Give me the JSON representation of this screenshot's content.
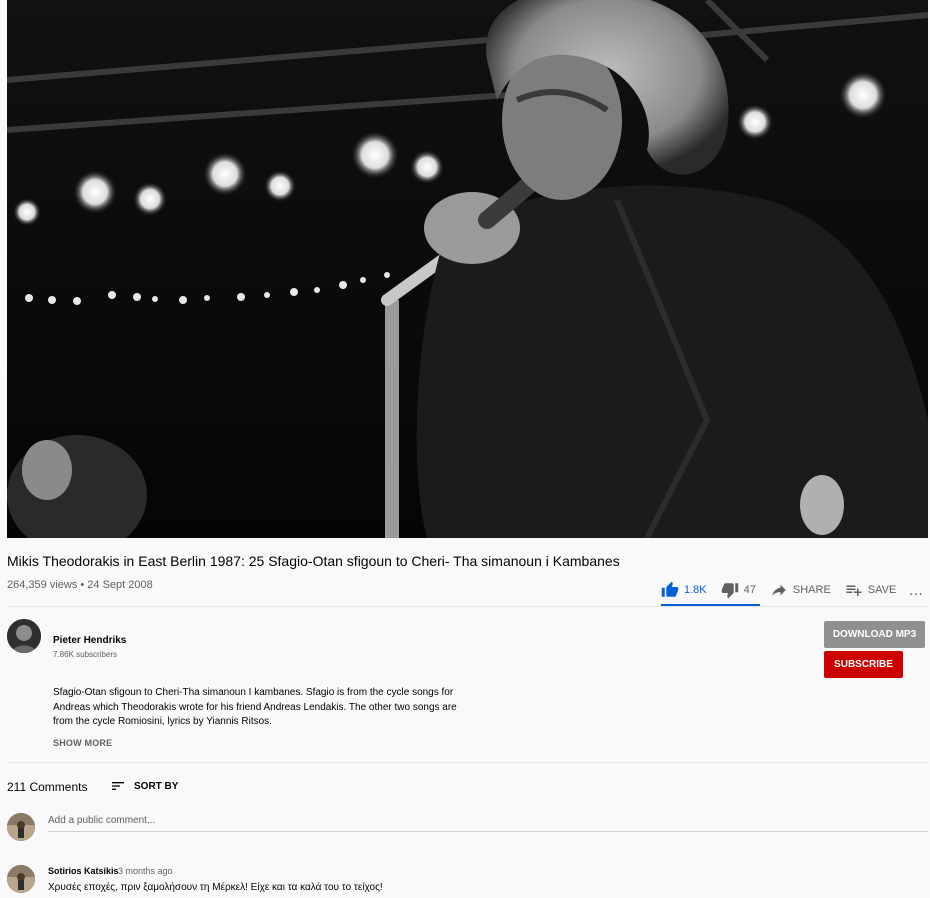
{
  "video": {
    "title": "Mikis Theodorakis in East Berlin 1987: 25 Sfagio-Otan sfigoun to Cheri- Tha simanoun i Kambanes",
    "meta": "264,359 views • 24 Sept 2008"
  },
  "actions": {
    "like_count": "1.8K",
    "dislike_count": "47",
    "share_label": "SHARE",
    "save_label": "SAVE",
    "more_label": "…",
    "accent_color": "#065fd4"
  },
  "channel": {
    "name": "Pieter Hendriks",
    "subscribers": "7.86K subscribers",
    "download_label": "DOWNLOAD MP3",
    "subscribe_label": "SUBSCRIBE",
    "subscribe_color": "#cc0000"
  },
  "description": {
    "lines": [
      "Sfagio-Otan sfigoun to Cheri-Tha simanoun I kambanes. Sfagio is from the cycle songs for",
      "Andreas which Theodorakis wrote for his friend Andreas Lendakis. The other two songs are",
      "from the cycle Romiosini, lyrics by Yiannis Ritsos."
    ],
    "show_more": "SHOW MORE"
  },
  "comments": {
    "count_label": "211 Comments",
    "sort_label": "SORT BY",
    "add_placeholder": "Add a public comment...",
    "items": [
      {
        "author": "Sotirios Katsikis",
        "time": "3 months ago",
        "text": "Χρυσές εποχές, πριν ξαμολήσουν τη Μέρκελ! Είχε και τα καλά του το τείχος!"
      }
    ]
  }
}
